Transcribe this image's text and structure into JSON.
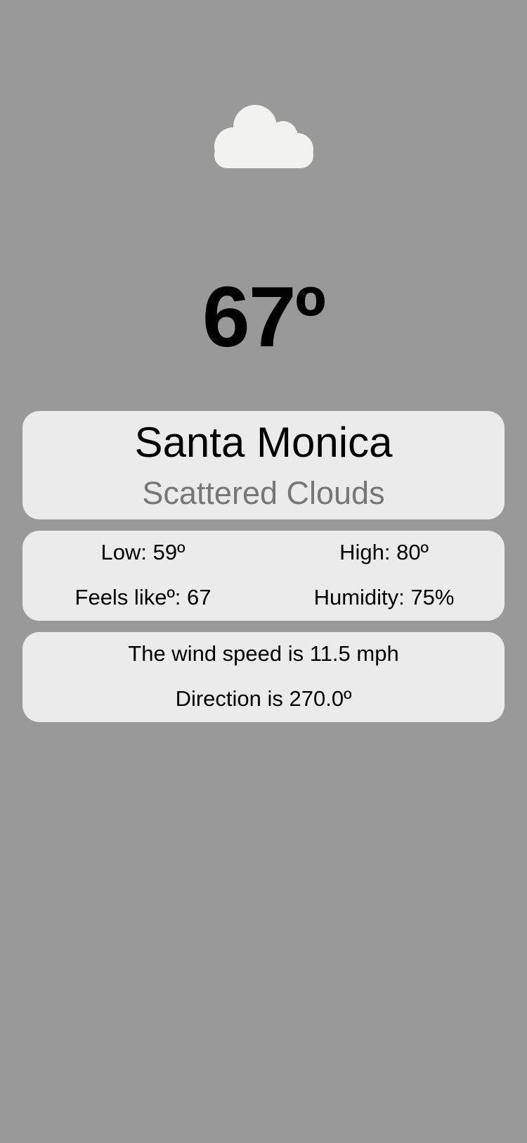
{
  "weather": {
    "icon": "cloud-icon",
    "temperature": "67º",
    "city": "Santa Monica",
    "description": "Scattered Clouds"
  },
  "stats": {
    "low": "Low: 59º",
    "high": "High: 80º",
    "feels_like": "Feels likeº: 67",
    "humidity": "Humidity: 75%"
  },
  "wind": {
    "speed": "The wind speed is 11.5 mph",
    "direction": "Direction is 270.0º"
  },
  "colors": {
    "background": "#999999",
    "card": "#ebebeb",
    "cloud": "#f2f2f0",
    "description_text": "#777777"
  }
}
